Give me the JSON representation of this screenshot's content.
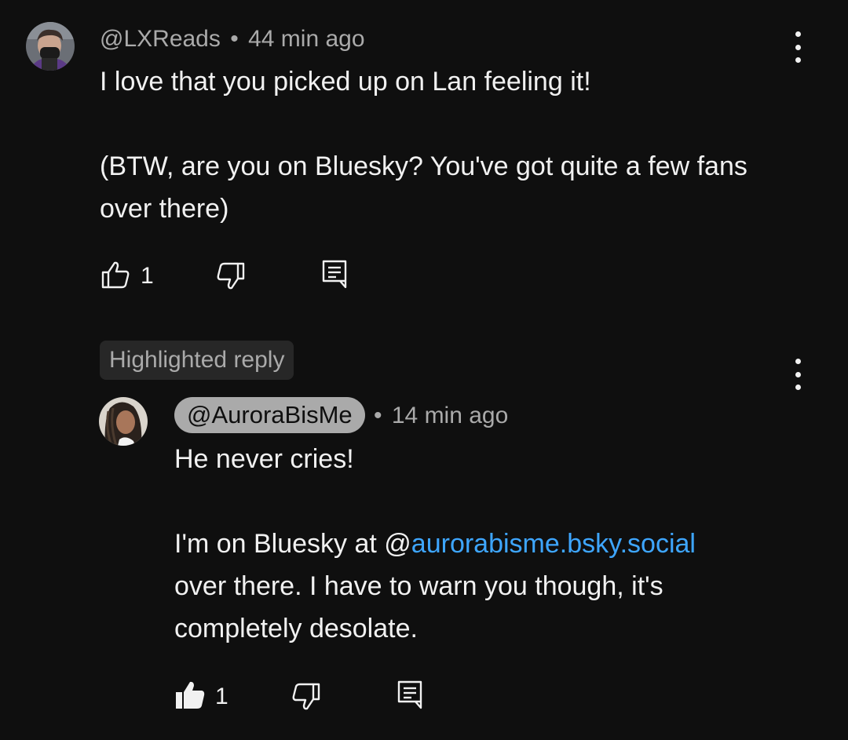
{
  "comment": {
    "author": "@LXReads",
    "separator": "•",
    "time": "44 min ago",
    "line1": "I love that you picked up on Lan feeling it!",
    "line2": "(BTW, are you on Bluesky? You've got quite a few fans",
    "line3": "over there)",
    "like_count": "1",
    "icons": {
      "like": "thumbs-up-outline-icon",
      "dislike": "thumbs-down-outline-icon",
      "reply": "comment-reply-icon",
      "menu": "more-vertical-icon"
    }
  },
  "reply": {
    "highlight_label": "Highlighted reply",
    "author": "@AuroraBisMe",
    "separator": "•",
    "time": "14 min ago",
    "line1": "He never cries!",
    "line2_prefix": "I'm on Bluesky at @",
    "line2_link": "aurorabisme.bsky.social",
    "line3": "over there. I have to warn you though, it's",
    "line4": "completely desolate.",
    "like_count": "1",
    "icons": {
      "like": "thumbs-up-filled-icon",
      "dislike": "thumbs-down-outline-icon",
      "reply": "comment-reply-icon",
      "menu": "more-vertical-icon"
    }
  },
  "colors": {
    "background": "#0f0f0f",
    "text": "#f1f1f1",
    "secondary_text": "#aaaaaa",
    "link": "#3ea6ff",
    "chip_bg": "#272727"
  }
}
